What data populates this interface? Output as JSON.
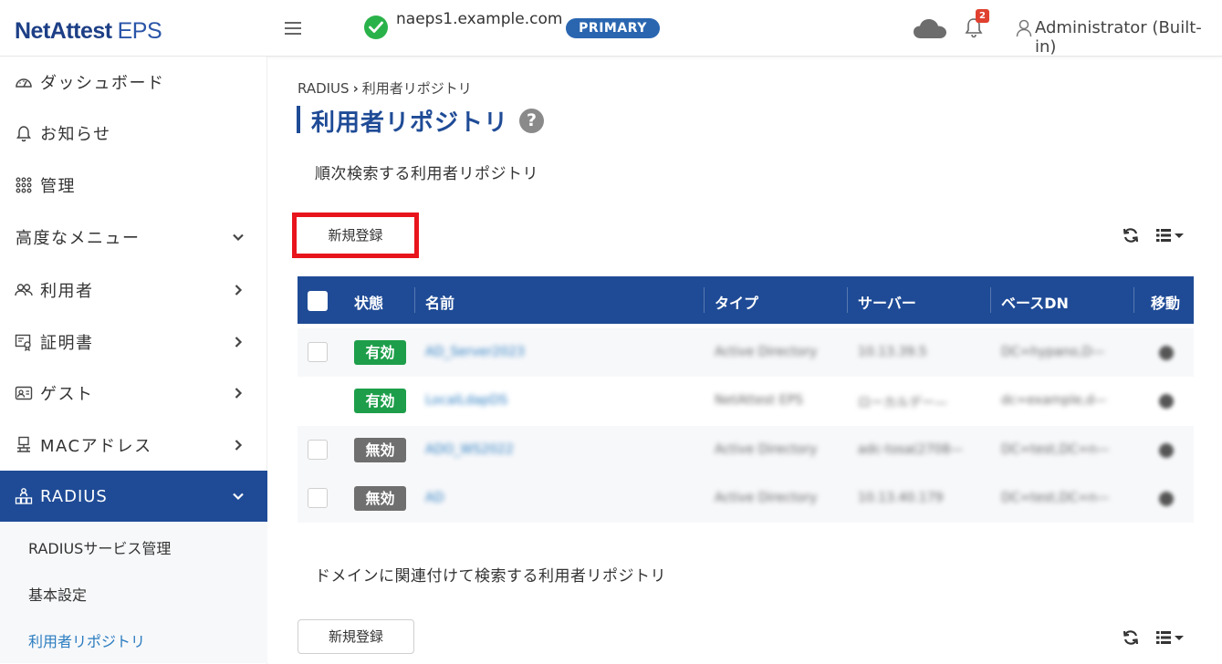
{
  "header": {
    "logo_main": "NetAttest",
    "logo_sub": "EPS",
    "host": "naeps1.example.com",
    "role_badge": "PRIMARY",
    "notification_count": "2",
    "user": "Administrator (Built-in)"
  },
  "sidebar": {
    "items": [
      {
        "label": "ダッシュボード"
      },
      {
        "label": "お知らせ"
      },
      {
        "label": "管理"
      },
      {
        "label": "高度なメニュー"
      },
      {
        "label": "利用者"
      },
      {
        "label": "証明書"
      },
      {
        "label": "ゲスト"
      },
      {
        "label": "MACアドレス"
      },
      {
        "label": "RADIUS"
      }
    ],
    "sub_items": [
      {
        "label": "RADIUSサービス管理"
      },
      {
        "label": "基本設定"
      },
      {
        "label": "利用者リポジトリ"
      }
    ]
  },
  "main": {
    "breadcrumb_root": "RADIUS",
    "breadcrumb_current": "利用者リポジトリ",
    "title": "利用者リポジトリ",
    "section1_title": "順次検索する利用者リポジトリ",
    "section2_title": "ドメインに関連付けて検索する利用者リポジトリ",
    "new_button": "新規登録",
    "table": {
      "headers": [
        "状態",
        "名前",
        "タイプ",
        "サーバー",
        "ベースDN",
        "移動"
      ],
      "rows": [
        {
          "status": "有効",
          "enabled": true,
          "name": "AD_Server2023",
          "type": "Active Directory",
          "server": "10.13.39.5",
          "basedn": "DC=hypano,D—"
        },
        {
          "status": "有効",
          "enabled": true,
          "name": "LocalLdapDS",
          "type": "NetAttest EPS",
          "server": "ローカルデー—",
          "basedn": "dc=example,d—"
        },
        {
          "status": "無効",
          "enabled": false,
          "name": "ADO_WS2022",
          "type": "Active Directory",
          "server": "adc-tosa(2708—",
          "basedn": "DC=test,DC=n—"
        },
        {
          "status": "無効",
          "enabled": false,
          "name": "AD",
          "type": "Active Directory",
          "server": "10.13.40.179",
          "basedn": "DC=test,DC=n—"
        }
      ]
    }
  },
  "colors": {
    "brand": "#1f4b96",
    "enabled": "#1e9e4a",
    "disabled": "#6f6f6f",
    "highlight": "#e8141c",
    "link": "#2a7cc0"
  }
}
